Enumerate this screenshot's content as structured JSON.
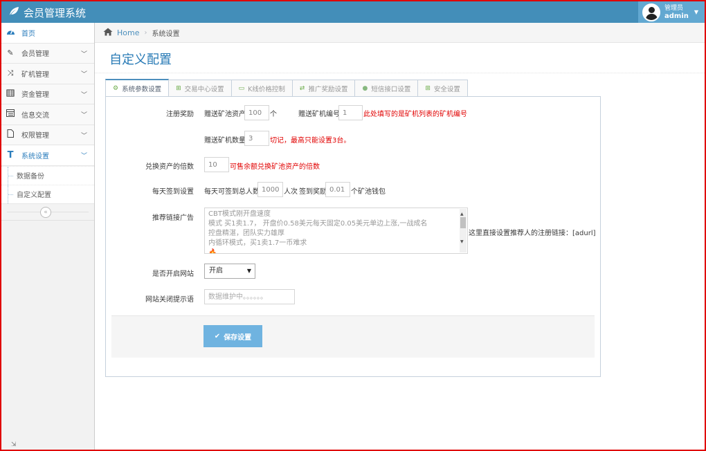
{
  "app": {
    "title": "会员管理系统"
  },
  "user": {
    "role": "管理员",
    "name": "admin"
  },
  "sidebar": {
    "items": [
      {
        "label": "首页",
        "icon": "dashboard-icon"
      },
      {
        "label": "会员管理",
        "icon": "edit-icon"
      },
      {
        "label": "矿机管理",
        "icon": "shuffle-icon"
      },
      {
        "label": "资金管理",
        "icon": "calendar-icon"
      },
      {
        "label": "信息交流",
        "icon": "list-icon"
      },
      {
        "label": "权限管理",
        "icon": "file-icon"
      },
      {
        "label": "系统设置",
        "icon": "text-icon"
      }
    ],
    "submenu": [
      "数据备份",
      "自定义配置"
    ]
  },
  "breadcrumb": {
    "home": "Home",
    "current": "系统设置"
  },
  "page": {
    "title": "自定义配置"
  },
  "tabs": [
    {
      "label": "系统参数设置",
      "icon": "cogs-icon"
    },
    {
      "label": "交易中心设置",
      "icon": "plus-square-icon"
    },
    {
      "label": "K线价格控制",
      "icon": "credit-card-icon"
    },
    {
      "label": "推广奖励设置",
      "icon": "exchange-icon"
    },
    {
      "label": "短信接口设置",
      "icon": "user-icon"
    },
    {
      "label": "安全设置",
      "icon": "plus-square-icon"
    }
  ],
  "form": {
    "register_reward": {
      "label": "注册奖励",
      "gift_asset_label": "赠送矿池资产",
      "gift_asset_value": "100",
      "gift_asset_unit": "个",
      "gift_machine_no_label": "赠送矿机编号",
      "gift_machine_no_value": "1",
      "gift_machine_no_hint": "此处填写的是矿机列表的矿机编号",
      "gift_machine_qty_label": "赠送矿机数量",
      "gift_machine_qty_value": "3",
      "gift_machine_qty_hint": "切记，最高只能设置3台。"
    },
    "exchange_multiple": {
      "label": "兑换资产的倍数",
      "value": "10",
      "hint": "可售余额兑换矿池资产的倍数"
    },
    "daily_checkin": {
      "label": "每天签到设置",
      "max_people_label": "每天可签到总人数",
      "max_people_value": "10000",
      "people_unit": "人次",
      "reward_label": "签到奖励",
      "reward_value": "0.01",
      "reward_unit": "个矿池钱包"
    },
    "referral_ad": {
      "label": "推荐链接广告",
      "lines": [
        "CBT模式刚开盘速度",
        "模式 买1卖1.7，  开盘价0.58美元每天固定0.05美元单边上涨,一战成名",
        " 控盘精湛，团队实力雄厚",
        " 内循环模式，买1卖1.7一币难求",
        " 🔥"
      ],
      "hint": "这里直接设置推荐人的注册链接：[adurl]"
    },
    "site_open": {
      "label": "是否开启网站",
      "selected": "开启"
    },
    "site_closed_msg": {
      "label": "网站关闭提示语",
      "placeholder": "数据维护中。。。。。。"
    },
    "save_label": "保存设置"
  },
  "colors": {
    "navbar": "#438eb9",
    "accent": "#2679b5",
    "save_button": "#6fb3e0",
    "hint_red": "#e10000"
  }
}
